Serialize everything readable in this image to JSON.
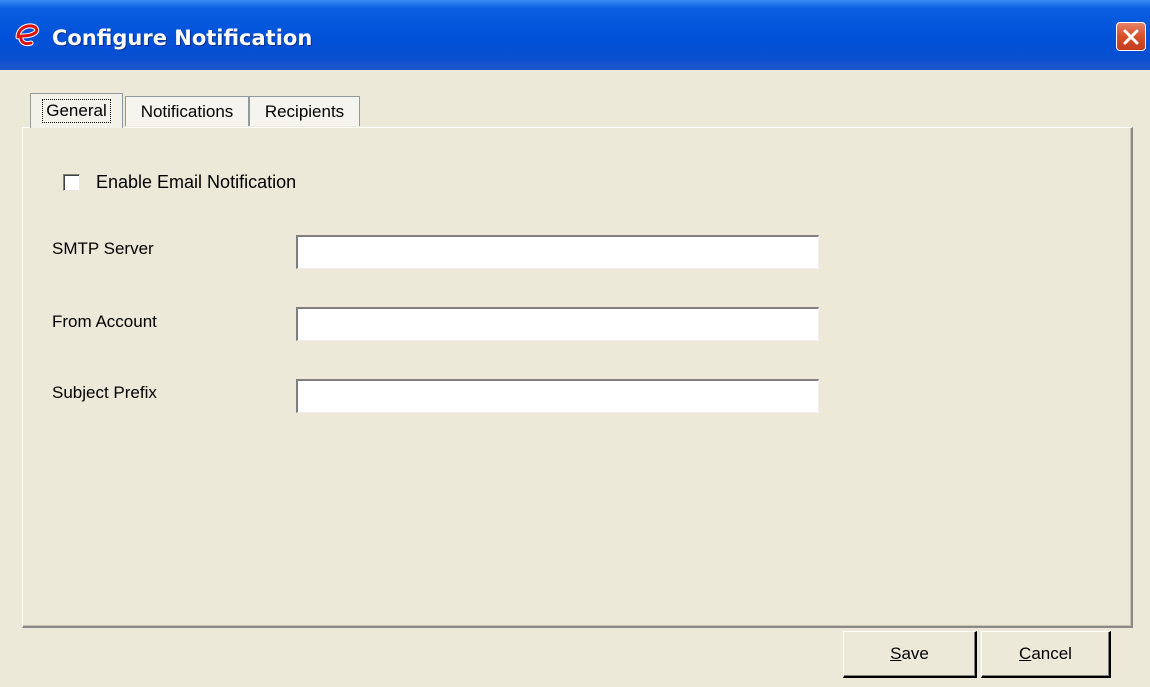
{
  "window": {
    "title": "Configure Notification",
    "icon": "app-e-logo-icon",
    "close_icon": "close-icon"
  },
  "tabs": [
    {
      "label": "General",
      "active": true
    },
    {
      "label": "Notifications",
      "active": false
    },
    {
      "label": "Recipients",
      "active": false
    }
  ],
  "general": {
    "enable_email": {
      "label": "Enable Email Notification",
      "checked": false
    },
    "fields": [
      {
        "label": "SMTP Server",
        "value": ""
      },
      {
        "label": "From Account",
        "value": ""
      },
      {
        "label": "Subject Prefix",
        "value": ""
      }
    ]
  },
  "buttons": {
    "save": {
      "mnemonic": "S",
      "rest": "ave"
    },
    "cancel": {
      "mnemonic": "C",
      "rest": "ancel"
    }
  },
  "colors": {
    "titlebar": "#0050d8",
    "dialog_bg": "#ece9d8",
    "close_button": "#d8522d",
    "logo_red": "#e01010"
  }
}
